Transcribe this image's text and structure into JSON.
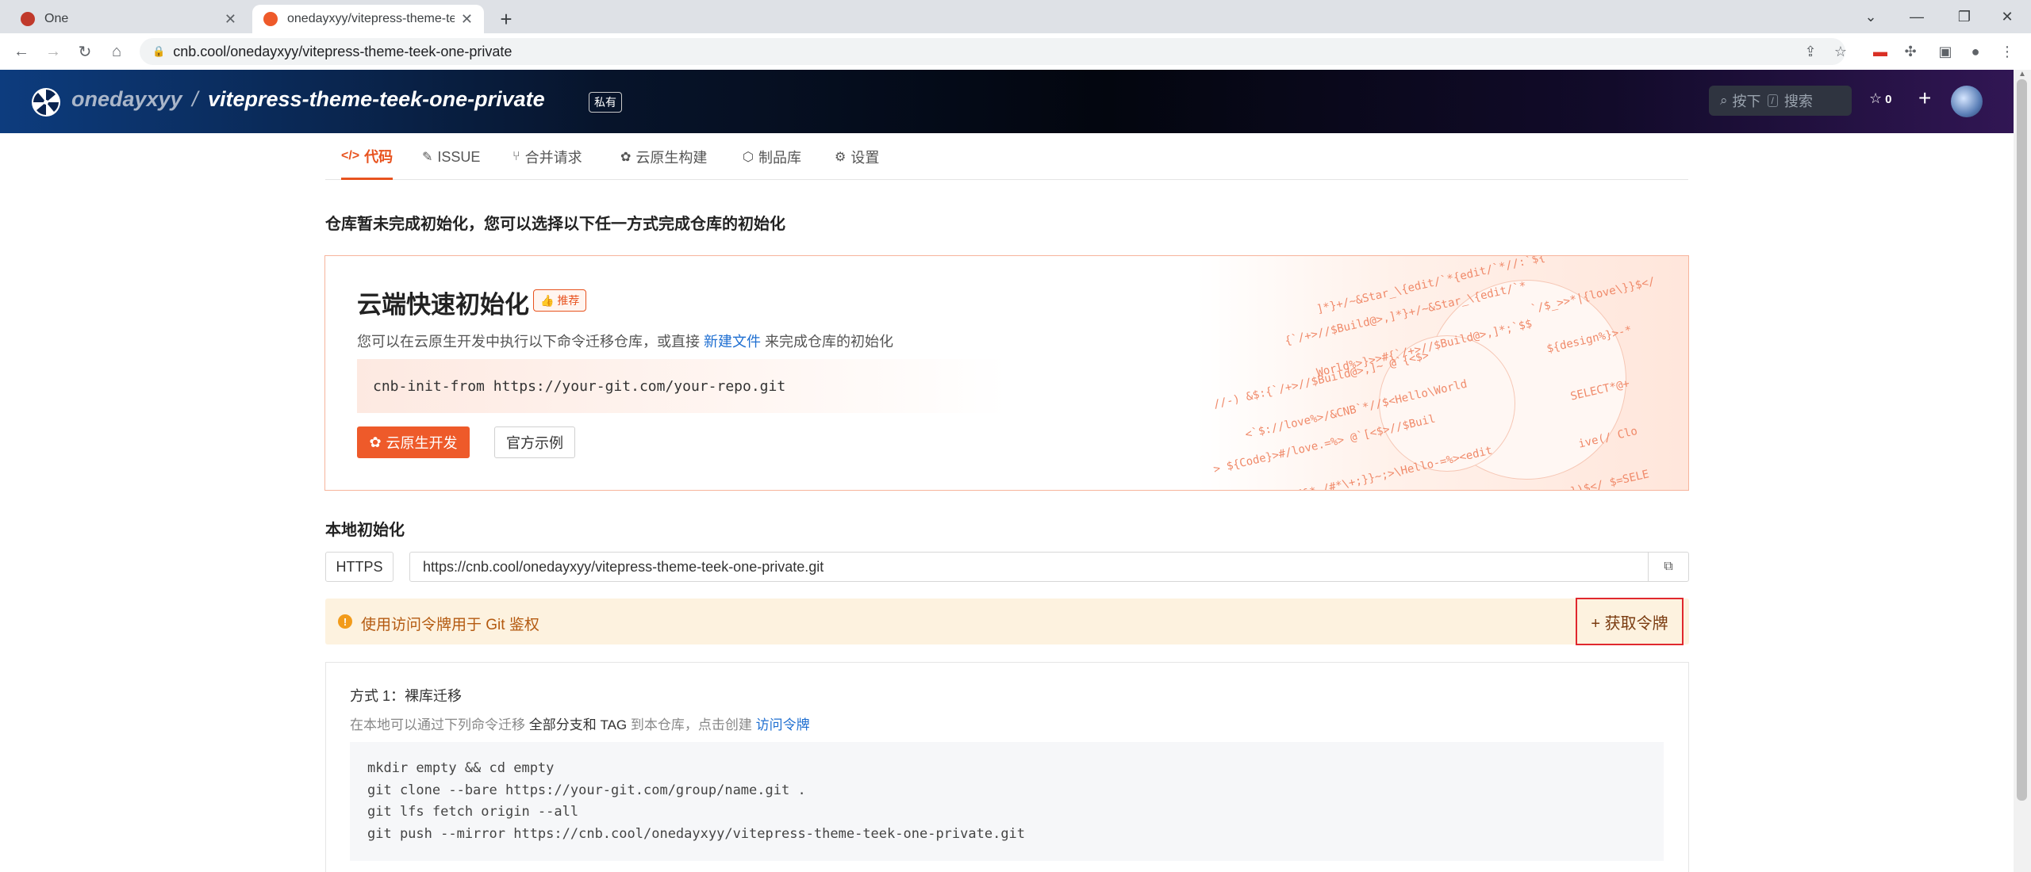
{
  "browser": {
    "tabs": [
      {
        "title": "One",
        "active": false
      },
      {
        "title": "onedayxyy/vitepress-theme-te",
        "active": true
      }
    ],
    "url": "cnb.cool/onedayxyy/vitepress-theme-teek-one-private"
  },
  "header": {
    "owner": "onedayxyy",
    "separator": "/",
    "repo": "vitepress-theme-teek-one-private",
    "private_badge": "私有",
    "search_label": "按下",
    "search_key": "/",
    "search_placeholder": "搜索",
    "star_count": "0"
  },
  "nav_tabs": [
    {
      "label": "代码",
      "icon": "code-icon",
      "active": true
    },
    {
      "label": "ISSUE",
      "icon": "edit-icon",
      "active": false
    },
    {
      "label": "合并请求",
      "icon": "merge-icon",
      "active": false
    },
    {
      "label": "云原生构建",
      "icon": "build-icon",
      "active": false
    },
    {
      "label": "制品库",
      "icon": "package-icon",
      "active": false
    },
    {
      "label": "设置",
      "icon": "gear-icon",
      "active": false
    }
  ],
  "main": {
    "heading": "仓库暂未完成初始化，您可以选择以下任一方式完成仓库的初始化",
    "cloud": {
      "title": "云端快速初始化",
      "badge": "推荐",
      "desc_before": "您可以在云原生开发中执行以下命令迁移仓库，或直接 ",
      "desc_link": "新建文件",
      "desc_after": " 来完成仓库的初始化",
      "command": "cnb-init-from https://your-git.com/your-repo.git",
      "primary_button": "云原生开发",
      "secondary_button": "官方示例"
    },
    "local": {
      "heading": "本地初始化",
      "protocol": "HTTPS",
      "clone_url": "https://cnb.cool/onedayxyy/vitepress-theme-teek-one-private.git"
    },
    "alert": {
      "text": "使用访问令牌用于 Git 鉴权",
      "action": "+ 获取令牌"
    },
    "method1": {
      "title": "方式 1：裸库迁移",
      "desc_before": "在本地可以通过下列命令迁移 ",
      "desc_highlight": "全部分支和 TAG",
      "desc_middle": " 到本仓库，点击创建 ",
      "desc_link": "访问令牌",
      "code_lines": [
        "mkdir empty && cd empty",
        "git clone --bare https://your-git.com/group/name.git .",
        "git lfs fetch origin --all",
        "git push --mirror https://cnb.cool/onedayxyy/vitepress-theme-teek-one-private.git"
      ]
    }
  },
  "colors": {
    "accent": "#e8531f",
    "link": "#1f6fd1",
    "alert_bg": "#fdf2df",
    "highlight_border": "#e0282e"
  }
}
